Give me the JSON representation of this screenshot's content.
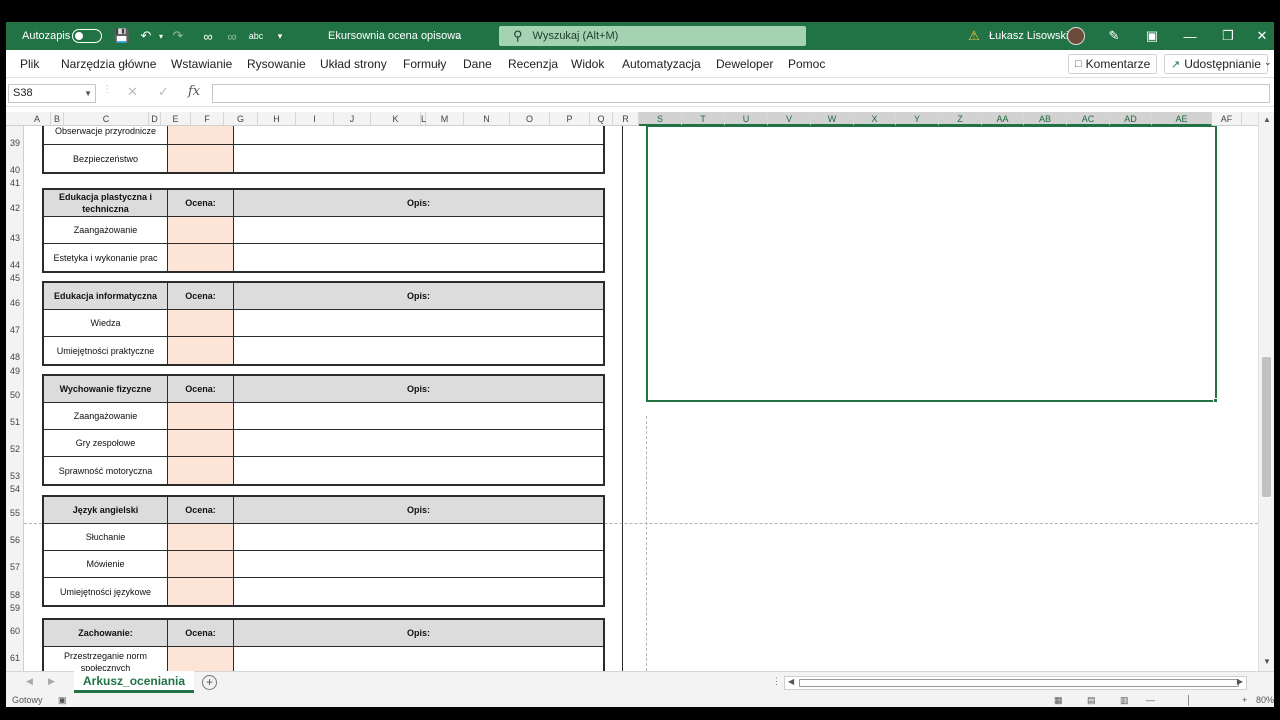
{
  "titlebar": {
    "autosave_label": "Autozapis",
    "doc_title": "Ekursownia ocena opisowa",
    "search_placeholder": "Wyszukaj (Alt+M)",
    "user_name": "Łukasz Lisowski"
  },
  "menu": {
    "items": [
      "Plik",
      "Narzędzia główne",
      "Wstawianie",
      "Rysowanie",
      "Układ strony",
      "Formuły",
      "Dane",
      "Recenzja",
      "Widok",
      "Automatyzacja",
      "Deweloper",
      "Pomoc"
    ],
    "comments_label": "Komentarze",
    "share_label": "Udostępnianie"
  },
  "formula_bar": {
    "name_box": "S38",
    "fx_label": "fx",
    "formula": ""
  },
  "columns": [
    "A",
    "B",
    "C",
    "D",
    "E",
    "F",
    "G",
    "H",
    "I",
    "J",
    "K",
    "L",
    "M",
    "N",
    "O",
    "P",
    "Q",
    "R",
    "S",
    "T",
    "U",
    "V",
    "W",
    "X",
    "Y",
    "Z",
    "AA",
    "AB",
    "AC",
    "AD",
    "AE",
    "AF"
  ],
  "selected_columns": [
    "S",
    "T",
    "U",
    "V",
    "W",
    "X",
    "Y",
    "Z",
    "AA",
    "AB",
    "AC",
    "AD",
    "AE"
  ],
  "rows": [
    "39",
    "40",
    "41",
    "42",
    "43",
    "44",
    "45",
    "46",
    "47",
    "48",
    "49",
    "50",
    "51",
    "52",
    "53",
    "54",
    "55",
    "56",
    "57",
    "58",
    "59",
    "60",
    "61"
  ],
  "grade_header": "Ocena:",
  "desc_header": "Opis:",
  "sections": [
    {
      "title": "",
      "items": [
        "Obserwacje przyrodnicze",
        "Bezpieczeństwo"
      ]
    },
    {
      "title": "Edukacja plastyczna i techniczna",
      "items": [
        "Zaangażowanie",
        "Estetyka i wykonanie prac"
      ]
    },
    {
      "title": "Edukacja informatyczna",
      "items": [
        "Wiedza",
        "Umiejętności praktyczne"
      ]
    },
    {
      "title": "Wychowanie fizyczne",
      "items": [
        "Zaangażowanie",
        "Gry zespołowe",
        "Sprawność motoryczna"
      ]
    },
    {
      "title": "Język angielski",
      "items": [
        "Słuchanie",
        "Mówienie",
        "Umiejętności językowe"
      ]
    },
    {
      "title": "Zachowanie:",
      "items": [
        "Przestrzeganie norm społecznych"
      ]
    }
  ],
  "sheet_tab": "Arkusz_oceniania",
  "status": {
    "ready": "Gotowy",
    "zoom": "80%"
  },
  "colors": {
    "excel_green": "#217346",
    "grade_cell_fill": "#fce4d6",
    "header_fill": "#dcdcdc"
  }
}
